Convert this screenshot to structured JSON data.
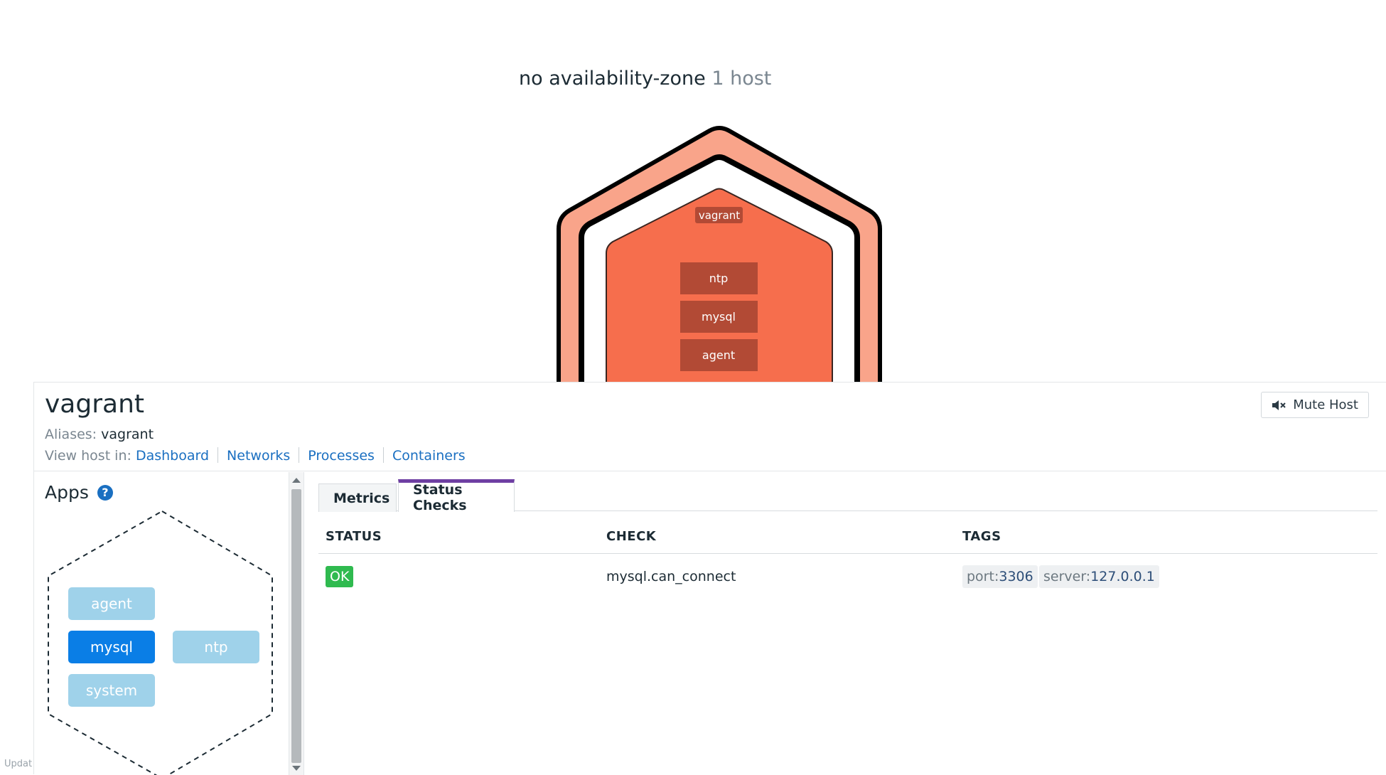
{
  "map": {
    "zone_name": "no availability-zone",
    "zone_count": "1 host",
    "host_label": "vagrant",
    "apps": [
      "ntp",
      "mysql",
      "agent"
    ],
    "colors": {
      "outer_hex": "#f9a48a",
      "inner_hex": "#f66e4d",
      "app_block": "#b24a35"
    }
  },
  "footer": {
    "updated_text": "Updat"
  },
  "host": {
    "name": "vagrant",
    "aliases_label": "Aliases:",
    "aliases_value": "vagrant",
    "view_in_label": "View host in:",
    "links": [
      "Dashboard",
      "Networks",
      "Processes",
      "Containers"
    ],
    "mute_label": "Mute Host",
    "mute_icon": "speaker-mute-icon"
  },
  "apps_pane": {
    "title": "Apps",
    "help_icon": "?",
    "items": [
      "agent",
      "mysql",
      "ntp",
      "system"
    ],
    "selected": "mysql"
  },
  "tabs": [
    "Metrics",
    "Status Checks"
  ],
  "active_tab": "Status Checks",
  "status_checks": {
    "headers": [
      "STATUS",
      "CHECK",
      "TAGS"
    ],
    "rows": [
      {
        "status": "OK",
        "check": "mysql.can_connect",
        "tags": [
          {
            "key": "port:",
            "value": "3306"
          },
          {
            "key": "server:",
            "value": "127.0.0.1"
          }
        ]
      }
    ],
    "ok_color": "#2fba4f"
  }
}
